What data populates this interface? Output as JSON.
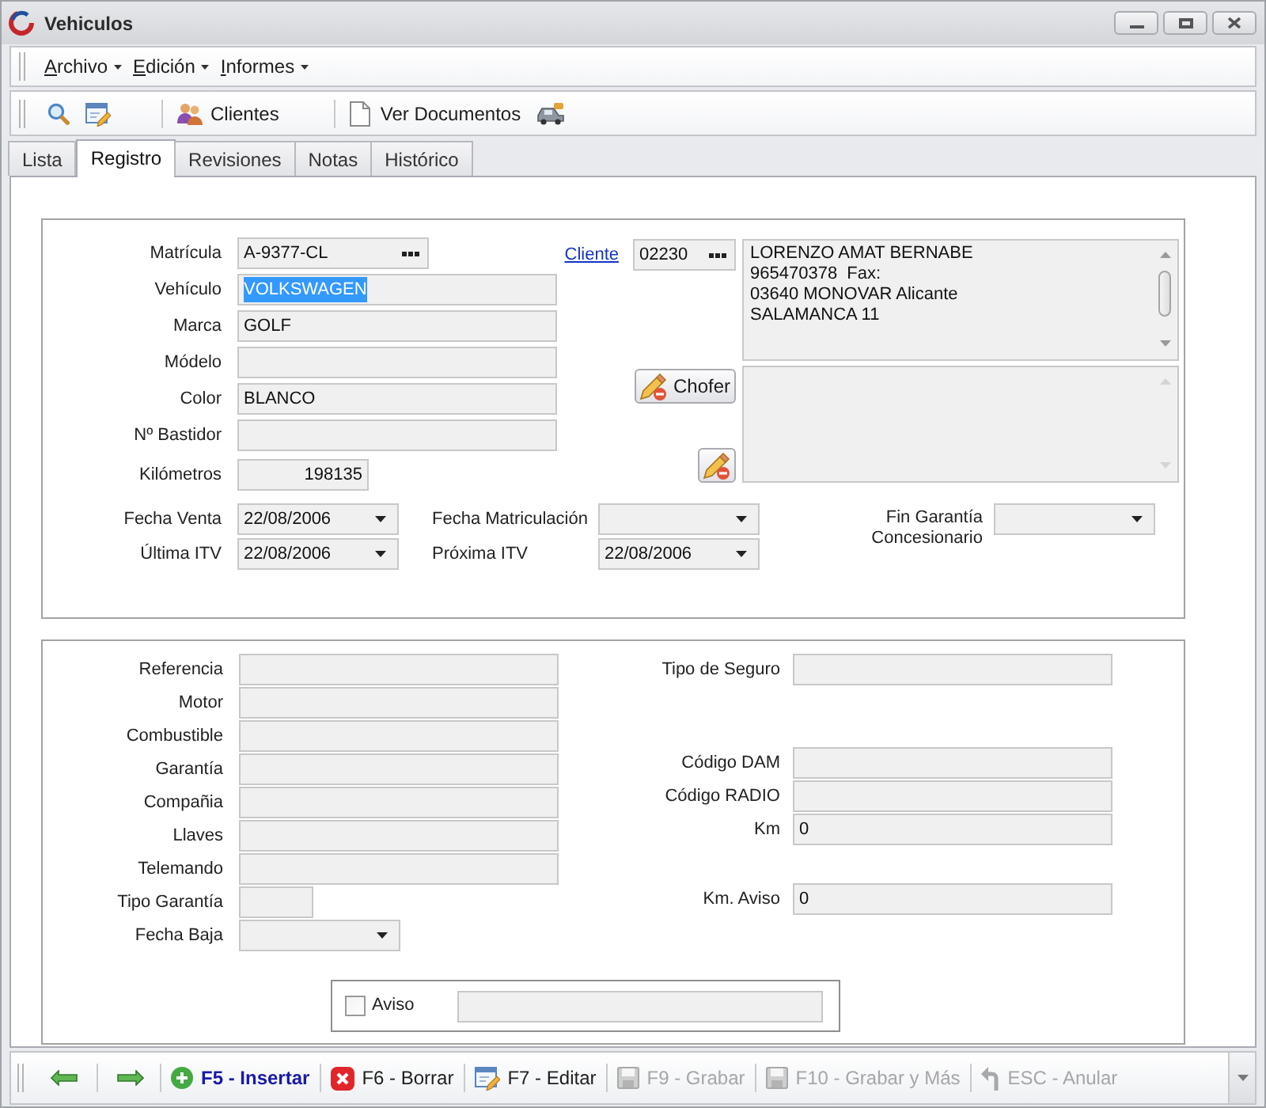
{
  "window": {
    "title": "Vehiculos"
  },
  "menu": [
    {
      "label": "Archivo"
    },
    {
      "label": "Edición"
    },
    {
      "label": "Informes"
    }
  ],
  "toolbar": {
    "buttons": [
      {
        "label": "Clientes"
      },
      {
        "label": "Ver Documentos"
      }
    ]
  },
  "tabs": [
    {
      "label": "Lista",
      "selected": false
    },
    {
      "label": "Registro",
      "selected": true
    },
    {
      "label": "Revisiones",
      "selected": false
    },
    {
      "label": "Notas",
      "selected": false
    },
    {
      "label": "Histórico",
      "selected": false
    }
  ],
  "vehicle": {
    "fields": [
      {
        "label": "Matrícula",
        "kind": "lookup",
        "value": "A-9377-CL",
        "text_selected": false
      },
      {
        "label": "Vehículo",
        "kind": "text",
        "value": "VOLKSWAGEN",
        "text_selected": true
      },
      {
        "label": "Marca",
        "kind": "text",
        "value": "GOLF",
        "text_selected": false
      },
      {
        "label": "Módelo",
        "kind": "text"
      },
      {
        "label": "Color",
        "kind": "text",
        "value": "BLANCO",
        "text_selected": false
      },
      {
        "label": "Nº Bastidor",
        "kind": "text"
      },
      {
        "label": "Kilómetros",
        "kind": "number",
        "value": "198135",
        "text_selected": false
      }
    ],
    "client": {
      "link": "Cliente",
      "code": "02230",
      "address": [
        "LORENZO AMAT BERNABE",
        "965470378  Fax:",
        "03640 MONOVAR Alicante",
        "SALAMANCA 11"
      ]
    },
    "driver_button": "Chofer",
    "dates": [
      [
        {
          "label": "Fecha Venta",
          "value": "22/08/2006"
        },
        {
          "label": "Fecha Matriculación"
        }
      ],
      [
        {
          "label": "Última ITV",
          "value": "22/08/2006"
        },
        {
          "label": "Próxima ITV",
          "value": "22/08/2006"
        }
      ]
    ],
    "warranty_end": {
      "label": "Fin Garantía Concesionario"
    }
  },
  "details": {
    "left_fields": [
      {
        "label": "Referencia",
        "kind": "text"
      },
      {
        "label": "Motor",
        "kind": "text"
      },
      {
        "label": "Combustible",
        "kind": "text"
      },
      {
        "label": "Garantía",
        "kind": "text"
      },
      {
        "label": "Compañia",
        "kind": "text"
      },
      {
        "label": "Llaves",
        "kind": "text"
      },
      {
        "label": "Telemando",
        "kind": "text"
      },
      {
        "label": "Tipo Garantía",
        "kind": "short"
      },
      {
        "label": "Fecha Baja",
        "kind": "date"
      }
    ],
    "right_groups": [
      [
        {
          "label": "Tipo de Seguro"
        }
      ],
      [
        {
          "label": "Código DAM"
        },
        {
          "label": "Código RADIO"
        },
        {
          "label": "Km",
          "value": "0"
        }
      ],
      [
        {
          "label": "Km. Aviso",
          "value": "0"
        }
      ]
    ],
    "notice": {
      "label": "Aviso",
      "checked": false
    }
  },
  "bottom_bar": {
    "buttons": [
      {
        "kind": "insert",
        "label": "F5 - Insertar",
        "primary": true,
        "disabled": false
      },
      {
        "kind": "delete",
        "label": "F6 - Borrar",
        "primary": false,
        "disabled": false
      },
      {
        "kind": "edit",
        "label": "F7 - Editar",
        "primary": false,
        "disabled": false
      },
      {
        "kind": "save",
        "label": "F9 - Grabar",
        "primary": false,
        "disabled": true
      },
      {
        "kind": "save",
        "label": "F10 - Grabar y Más",
        "primary": false,
        "disabled": true
      },
      {
        "kind": "cancel",
        "label": "ESC - Anular",
        "primary": false,
        "disabled": true
      }
    ]
  }
}
